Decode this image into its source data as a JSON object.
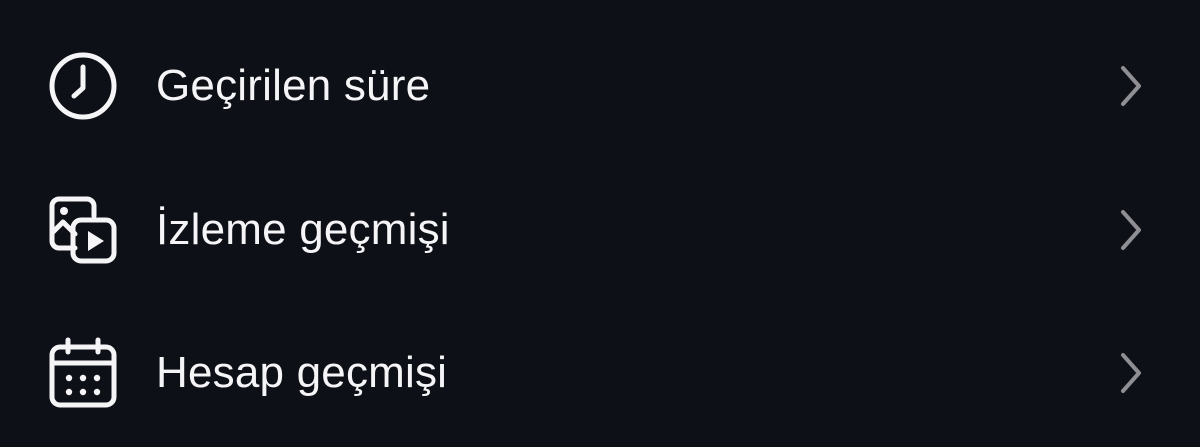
{
  "menu": {
    "items": [
      {
        "label": "Geçirilen süre",
        "icon": "clock-icon"
      },
      {
        "label": "İzleme geçmişi",
        "icon": "video-history-icon"
      },
      {
        "label": "Hesap geçmişi",
        "icon": "calendar-icon"
      }
    ]
  },
  "colors": {
    "background": "#0e1017",
    "text": "#f5f5f7",
    "chevron": "#8e8e93"
  }
}
